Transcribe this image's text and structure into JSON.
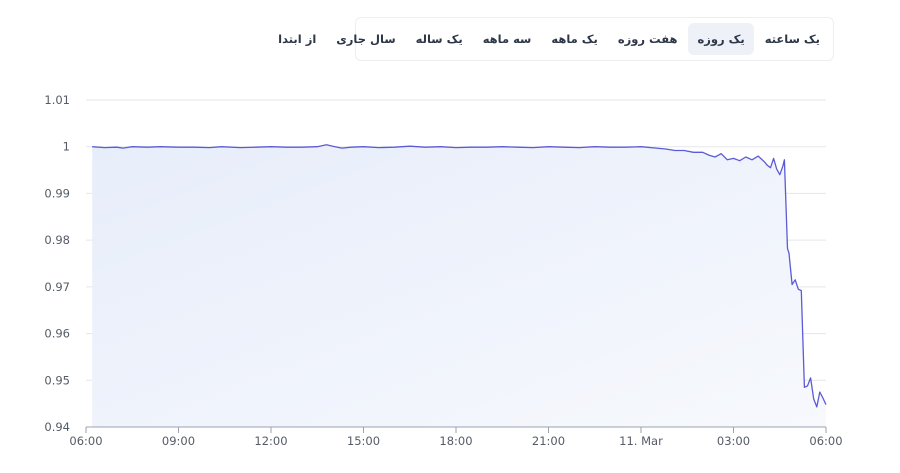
{
  "range_selector": {
    "selected_index": 1,
    "options": [
      "یک ساعته",
      "یک روزه",
      "هفت روزه",
      "یک ماهه",
      "سه ماهه",
      "یک ساله",
      "سال جاری",
      "از ابتدا"
    ]
  },
  "colors": {
    "line": "#5b5bd6",
    "area_top": "#e7edfa",
    "area_bottom": "#f7f9fd",
    "grid": "#e5e7eb",
    "axis": "#9aa3b2"
  },
  "chart_data": {
    "type": "area",
    "title": "",
    "xlabel": "",
    "ylabel": "",
    "ylim": [
      0.94,
      1.01
    ],
    "xlim_hours": [
      0,
      24
    ],
    "yticks": [
      "1.01",
      "1",
      "0.99",
      "0.98",
      "0.97",
      "0.96",
      "0.95",
      "0.94"
    ],
    "ytick_values": [
      1.01,
      1.0,
      0.99,
      0.98,
      0.97,
      0.96,
      0.95,
      0.94
    ],
    "xticks": [
      "06:00",
      "09:00",
      "12:00",
      "15:00",
      "18:00",
      "21:00",
      "11. Mar",
      "03:00",
      "06:00"
    ],
    "xtick_hours": [
      0,
      3,
      6,
      9,
      12,
      15,
      18,
      21,
      24
    ],
    "grid": true,
    "series": [
      {
        "x_hours": [
          0.2,
          0.6,
          1.0,
          1.2,
          1.5,
          2.0,
          2.4,
          3.0,
          3.5,
          4.0,
          4.4,
          5.0,
          5.5,
          6.0,
          6.5,
          7.0,
          7.5,
          7.8,
          8.0,
          8.3,
          8.6,
          9.0,
          9.5,
          10.0,
          10.5,
          11.0,
          11.5,
          12.0,
          12.5,
          13.0,
          13.5,
          14.0,
          14.5,
          15.0,
          15.5,
          16.0,
          16.5,
          17.0,
          17.5,
          18.0,
          18.5,
          18.8,
          19.1,
          19.4,
          19.7,
          20.0,
          20.2,
          20.4,
          20.6,
          20.8,
          21.0,
          21.2,
          21.4,
          21.6,
          21.8,
          22.0,
          22.1,
          22.2,
          22.3,
          22.4,
          22.5,
          22.6,
          22.65,
          22.75,
          22.8,
          22.9,
          23.0,
          23.1,
          23.2,
          23.3,
          23.4,
          23.5,
          23.6,
          23.7,
          23.8,
          23.9,
          24.0
        ],
        "values": [
          1.0,
          0.9998,
          0.9999,
          0.9997,
          1.0,
          0.9999,
          1.0,
          0.9999,
          0.9999,
          0.9998,
          1.0,
          0.9998,
          0.9999,
          1.0,
          0.9999,
          0.9999,
          1.0,
          1.0004,
          1.0001,
          0.9997,
          0.9999,
          1.0,
          0.9998,
          0.9999,
          1.0001,
          0.9999,
          1.0,
          0.9998,
          0.9999,
          0.9999,
          1.0,
          0.9999,
          0.9998,
          1.0,
          0.9999,
          0.9998,
          1.0,
          0.9999,
          0.9999,
          1.0,
          0.9997,
          0.9995,
          0.9992,
          0.9992,
          0.9988,
          0.9988,
          0.9982,
          0.9978,
          0.9985,
          0.9972,
          0.9975,
          0.997,
          0.9978,
          0.9972,
          0.998,
          0.9968,
          0.996,
          0.9955,
          0.9975,
          0.9952,
          0.994,
          0.9958,
          0.9972,
          0.9782,
          0.9772,
          0.9705,
          0.9715,
          0.9695,
          0.9692,
          0.9485,
          0.9488,
          0.9505,
          0.946,
          0.9443,
          0.9475,
          0.9462,
          0.9448
        ]
      }
    ]
  }
}
